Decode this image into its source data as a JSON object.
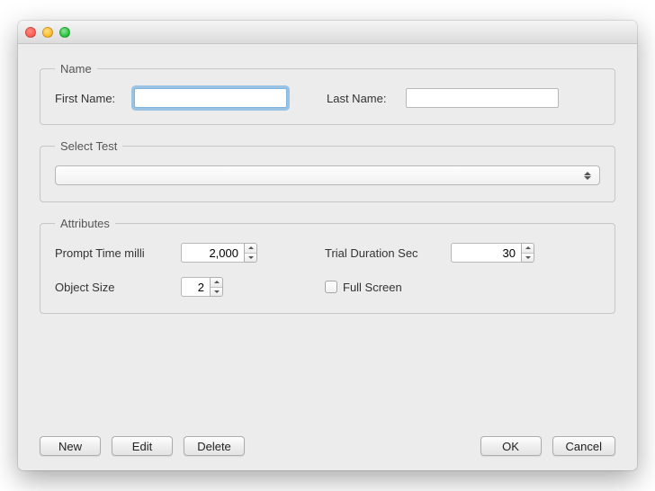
{
  "groups": {
    "name": {
      "legend": "Name",
      "first_label": "First Name:",
      "first_value": "",
      "last_label": "Last Name:",
      "last_value": ""
    },
    "select_test": {
      "legend": "Select Test",
      "selected": ""
    },
    "attributes": {
      "legend": "Attributes",
      "prompt_time_label": "Prompt Time milli",
      "prompt_time_value": "2,000",
      "trial_duration_label": "Trial Duration Sec",
      "trial_duration_value": "30",
      "object_size_label": "Object Size",
      "object_size_value": "2",
      "full_screen_label": "Full Screen",
      "full_screen_checked": false
    }
  },
  "buttons": {
    "new": "New",
    "edit": "Edit",
    "delete": "Delete",
    "ok": "OK",
    "cancel": "Cancel"
  }
}
